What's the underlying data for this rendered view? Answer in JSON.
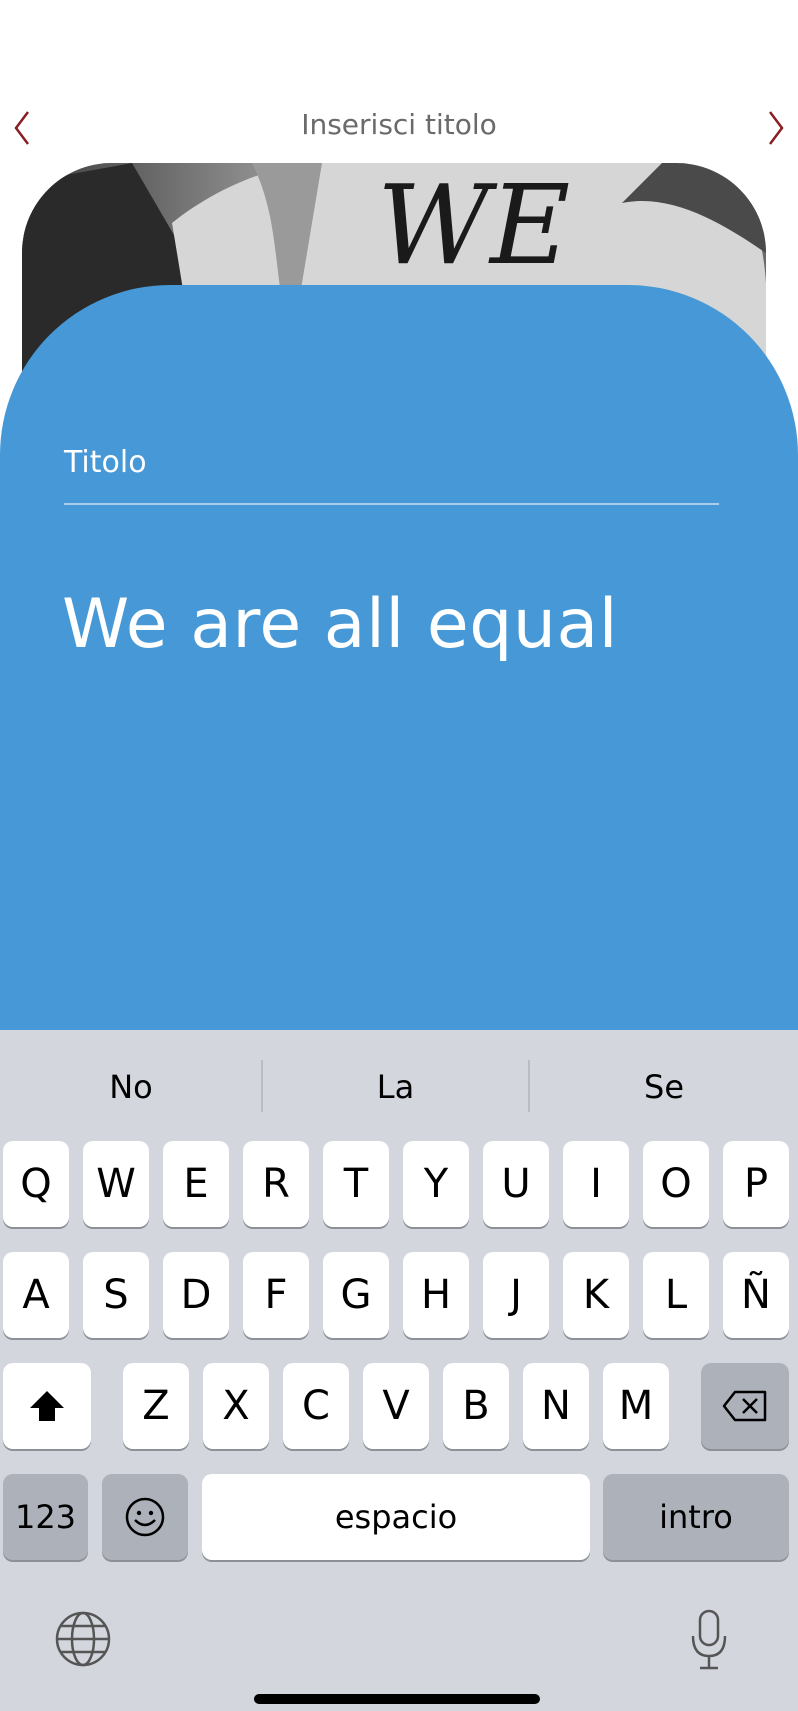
{
  "header": {
    "title": "Inserisci titolo",
    "arrow_color": "#8b1d24"
  },
  "photo": {
    "description_icon": "photo-we-hand"
  },
  "form": {
    "label": "Titolo",
    "value": "We are all equal",
    "panel_color": "#4698d6"
  },
  "keyboard": {
    "suggestions": [
      "No",
      "La",
      "Se"
    ],
    "row1": [
      "Q",
      "W",
      "E",
      "R",
      "T",
      "Y",
      "U",
      "I",
      "O",
      "P"
    ],
    "row2": [
      "A",
      "S",
      "D",
      "F",
      "G",
      "H",
      "J",
      "K",
      "L",
      "Ñ"
    ],
    "row3": [
      "Z",
      "X",
      "C",
      "V",
      "B",
      "N",
      "M"
    ],
    "numbers_label": "123",
    "space_label": "espacio",
    "enter_label": "intro",
    "background": "#d3d6dc"
  }
}
